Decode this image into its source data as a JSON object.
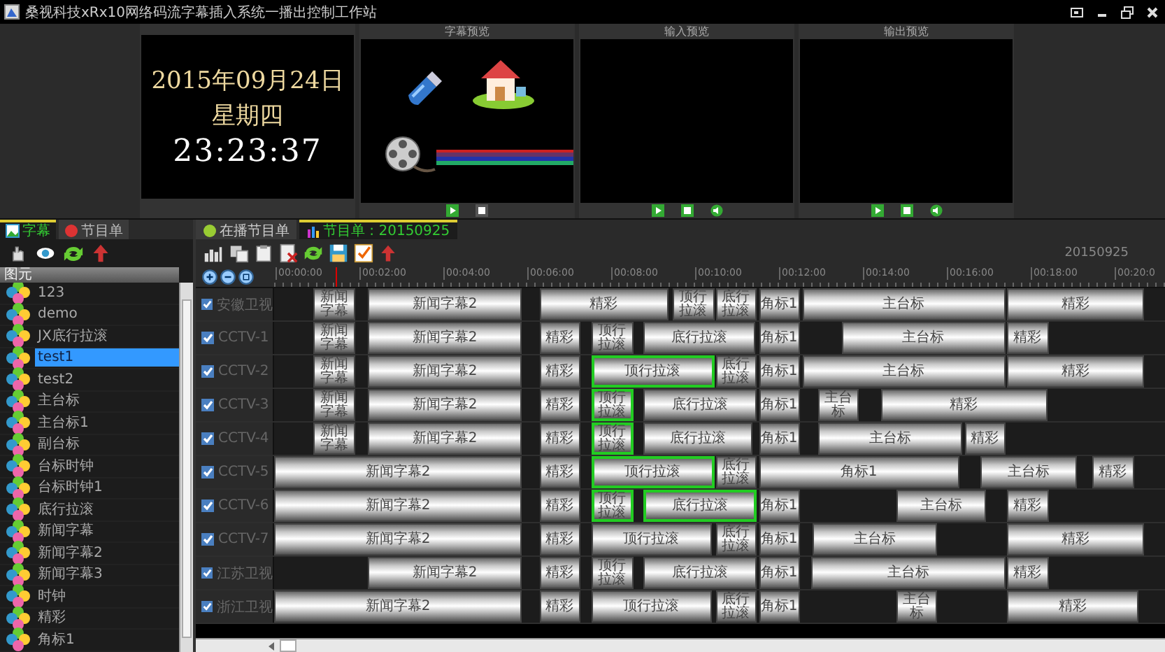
{
  "window": {
    "title": "桑视科技xRx10网络码流字幕插入系统一播出控制工作站"
  },
  "clock": {
    "date": "2015年09月24日",
    "weekday": "星期四",
    "time": "23:23:37"
  },
  "previews": [
    {
      "title": "字幕预览",
      "kind": "caption"
    },
    {
      "title": "输入预览",
      "kind": "video"
    },
    {
      "title": "输出预览",
      "kind": "video"
    }
  ],
  "library": {
    "tabs": [
      {
        "label": "字幕",
        "selected": true
      },
      {
        "label": "节目单",
        "selected": false
      }
    ],
    "header": "图元",
    "items": [
      {
        "label": "123",
        "selected": false
      },
      {
        "label": "demo",
        "selected": false
      },
      {
        "label": "JX底行拉滚",
        "selected": false
      },
      {
        "label": "test1",
        "selected": true
      },
      {
        "label": "test2",
        "selected": false
      },
      {
        "label": "主台标",
        "selected": false
      },
      {
        "label": "主台标1",
        "selected": false
      },
      {
        "label": "副台标",
        "selected": false
      },
      {
        "label": "台标时钟",
        "selected": false
      },
      {
        "label": "台标时钟1",
        "selected": false
      },
      {
        "label": "底行拉滚",
        "selected": false
      },
      {
        "label": "新闻字幕",
        "selected": false
      },
      {
        "label": "新闻字幕2",
        "selected": false
      },
      {
        "label": "新闻字幕3",
        "selected": false
      },
      {
        "label": "时钟",
        "selected": false
      },
      {
        "label": "精彩",
        "selected": false
      },
      {
        "label": "角标1",
        "selected": false
      }
    ]
  },
  "schedule": {
    "tabs": [
      {
        "label": "在播节目单",
        "selected": false
      },
      {
        "label": "节目单 : 20150925",
        "selected": true
      }
    ],
    "date": "20150925",
    "ticks": [
      "00:00:00",
      "00:02:00",
      "00:04:00",
      "00:06:00",
      "00:08:00",
      "00:10:00",
      "00:12:00",
      "00:14:00",
      "00:16:00",
      "00:18:00",
      "00:20:0"
    ],
    "tracks": [
      {
        "name": "安徽卫视",
        "checked": true,
        "clips": [
          {
            "label": "新闻字幕",
            "selected": false
          },
          {
            "label": "新闻字幕2",
            "selected": false
          },
          {
            "label": "精彩",
            "selected": false
          },
          {
            "label": "顶行拉滚",
            "selected": false
          },
          {
            "label": "底行拉滚",
            "selected": false
          },
          {
            "label": "角标1",
            "selected": false
          },
          {
            "label": "主台标",
            "selected": false
          },
          {
            "label": "精彩",
            "selected": false
          }
        ]
      },
      {
        "name": "CCTV-1",
        "checked": true,
        "clips": [
          {
            "label": "新闻字幕",
            "selected": false
          },
          {
            "label": "新闻字幕2",
            "selected": false
          },
          {
            "label": "精彩",
            "selected": false
          },
          {
            "label": "顶行拉滚",
            "selected": false
          },
          {
            "label": "底行拉滚",
            "selected": false
          },
          {
            "label": "角标1",
            "selected": false
          },
          {
            "label": "主台标",
            "selected": false
          },
          {
            "label": "精彩",
            "selected": false
          }
        ]
      },
      {
        "name": "CCTV-2",
        "checked": true,
        "clips": [
          {
            "label": "新闻字幕",
            "selected": false
          },
          {
            "label": "新闻字幕2",
            "selected": false
          },
          {
            "label": "精彩",
            "selected": false
          },
          {
            "label": "顶行拉滚",
            "selected": true
          },
          {
            "label": "底行拉滚",
            "selected": false
          },
          {
            "label": "角标1",
            "selected": false
          },
          {
            "label": "主台标",
            "selected": false
          },
          {
            "label": "精彩",
            "selected": false
          }
        ]
      },
      {
        "name": "CCTV-3",
        "checked": true,
        "clips": [
          {
            "label": "新闻字幕",
            "selected": false
          },
          {
            "label": "新闻字幕2",
            "selected": false
          },
          {
            "label": "精彩",
            "selected": false
          },
          {
            "label": "顶行拉滚",
            "selected": true
          },
          {
            "label": "底行拉滚",
            "selected": false
          },
          {
            "label": "角标1",
            "selected": false
          },
          {
            "label": "主台标",
            "selected": false
          },
          {
            "label": "精彩",
            "selected": false
          }
        ]
      },
      {
        "name": "CCTV-4",
        "checked": true,
        "clips": [
          {
            "label": "新闻字幕",
            "selected": false
          },
          {
            "label": "新闻字幕2",
            "selected": false
          },
          {
            "label": "精彩",
            "selected": false
          },
          {
            "label": "顶行拉滚",
            "selected": true
          },
          {
            "label": "底行拉滚",
            "selected": false
          },
          {
            "label": "角标1",
            "selected": false
          },
          {
            "label": "主台标",
            "selected": false
          },
          {
            "label": "精彩",
            "selected": false
          }
        ]
      },
      {
        "name": "CCTV-5",
        "checked": true,
        "clips": [
          {
            "label": "新闻字幕2",
            "selected": false
          },
          {
            "label": "精彩",
            "selected": false
          },
          {
            "label": "顶行拉滚",
            "selected": true
          },
          {
            "label": "底行拉滚",
            "selected": false
          },
          {
            "label": "角标1",
            "selected": false
          },
          {
            "label": "主台标",
            "selected": false
          },
          {
            "label": "精彩",
            "selected": false
          }
        ]
      },
      {
        "name": "CCTV-6",
        "checked": true,
        "clips": [
          {
            "label": "新闻字幕2",
            "selected": false
          },
          {
            "label": "精彩",
            "selected": false
          },
          {
            "label": "顶行拉滚",
            "selected": true
          },
          {
            "label": "底行拉滚",
            "selected": true
          },
          {
            "label": "角标1",
            "selected": false
          },
          {
            "label": "主台标",
            "selected": false
          },
          {
            "label": "精彩",
            "selected": false
          }
        ]
      },
      {
        "name": "CCTV-7",
        "checked": true,
        "clips": [
          {
            "label": "新闻字幕2",
            "selected": false
          },
          {
            "label": "精彩",
            "selected": false
          },
          {
            "label": "顶行拉滚",
            "selected": false
          },
          {
            "label": "底行拉滚",
            "selected": false
          },
          {
            "label": "角标1",
            "selected": false
          },
          {
            "label": "主台标",
            "selected": false
          },
          {
            "label": "精彩",
            "selected": false
          }
        ]
      },
      {
        "name": "江苏卫视",
        "checked": true,
        "clips": [
          {
            "label": "新闻字幕2",
            "selected": false
          },
          {
            "label": "精彩",
            "selected": false
          },
          {
            "label": "顶行拉滚",
            "selected": false
          },
          {
            "label": "底行拉滚",
            "selected": false
          },
          {
            "label": "角标1",
            "selected": false
          },
          {
            "label": "主台标",
            "selected": false
          },
          {
            "label": "精彩",
            "selected": false
          }
        ]
      },
      {
        "name": "浙江卫视",
        "checked": true,
        "clips": [
          {
            "label": "新闻字幕2",
            "selected": false
          },
          {
            "label": "精彩",
            "selected": false
          },
          {
            "label": "顶行拉滚",
            "selected": false
          },
          {
            "label": "底行拉滚",
            "selected": false
          },
          {
            "label": "角标1",
            "selected": false
          },
          {
            "label": "主台标",
            "selected": false
          },
          {
            "label": "精彩",
            "selected": false
          }
        ]
      }
    ]
  }
}
